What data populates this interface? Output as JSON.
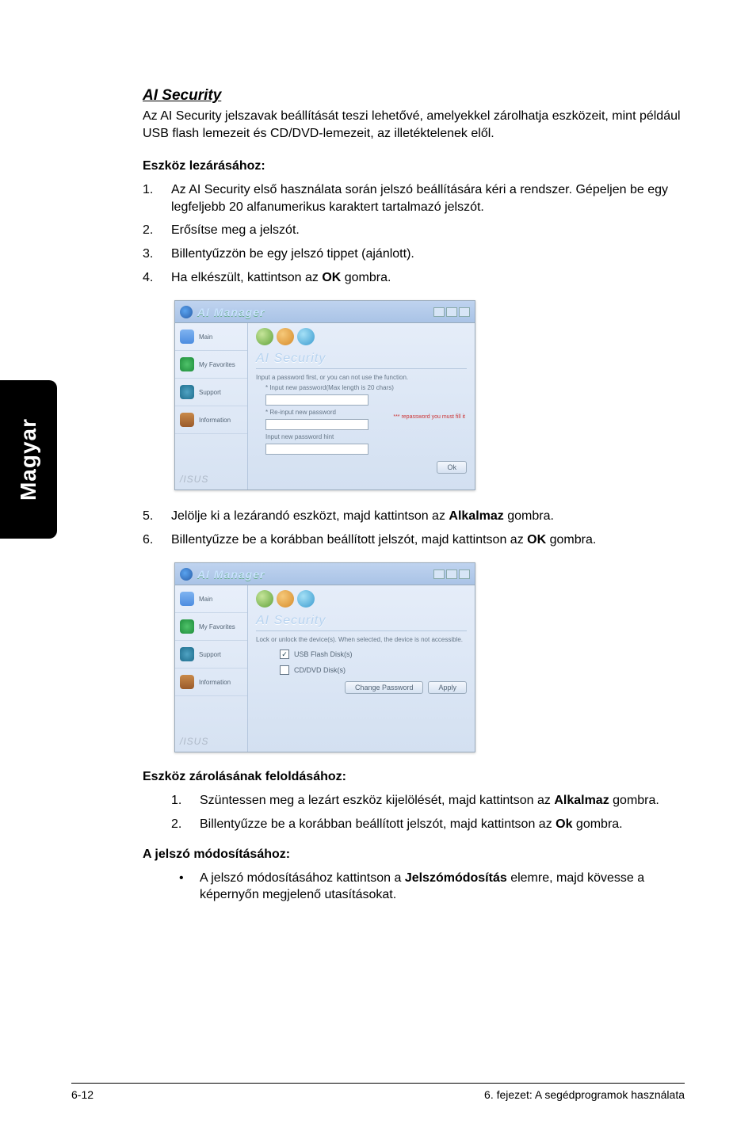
{
  "side_tab": "Magyar",
  "section_title": "AI Security",
  "intro": "Az AI Security jelszavak beállítását teszi lehetővé, amelyekkel zárolhatja eszközeit, mint például USB flash lemezeit és CD/DVD-lemezeit, az illetéktelenek elől.",
  "lock_heading": "Eszköz lezárásához:",
  "lock_steps": [
    "Az AI Security első használata során jelszó beállítására kéri a rendszer. Gépeljen be egy legfeljebb 20 alfanumerikus karaktert tartalmazó jelszót.",
    "Erősítse meg a jelszót.",
    "Billentyűzzön be egy jelszó tippet (ajánlott).",
    "Ha elkészült, kattintson az <b>OK</b> gombra."
  ],
  "lock_steps2": [
    "Jelölje ki a lezárandó eszközt, majd kattintson az <b>Alkalmaz</b> gombra.",
    "Billentyűzze be a korábban beállított jelszót, majd kattintson az <b>OK</b> gombra."
  ],
  "unlock_heading": "Eszköz zárolásának feloldásához:",
  "unlock_steps": [
    "Szüntessen meg a lezárt eszköz kijelölését, majd kattintson az <b>Alkalmaz</b> gombra.",
    "Billentyűzze be a korábban beállított jelszót, majd kattintson az <b>Ok</b> gombra."
  ],
  "change_heading": "A jelszó módosításához:",
  "change_bullet": "A jelszó módosításához kattintson a <b>Jelszómódosítás</b> elemre, majd kövesse a képernyőn megjelenő utasításokat.",
  "mock": {
    "title": "AI Manager",
    "side_main": "Main",
    "side_fav": "My Favorites",
    "side_sup": "Support",
    "side_info": "Information",
    "brand": "/ISUS",
    "panel_title": "AI Security",
    "hint1": "Input a password first, or you can not use the function.",
    "hint2": "* Input new password(Max length is 20 chars)",
    "hint3": "* Re-input new password",
    "hint4": "Input new password hint",
    "warn": "*** repassword you must fill it",
    "ok": "Ok",
    "desc2": "Lock or unlock the device(s). When selected, the device is not accessible.",
    "cb1": "USB Flash Disk(s)",
    "cb2": "CD/DVD Disk(s)",
    "btn_change": "Change Password",
    "btn_apply": "Apply"
  },
  "footer_left": "6-12",
  "footer_right": "6. fejezet: A segédprogramok használata"
}
